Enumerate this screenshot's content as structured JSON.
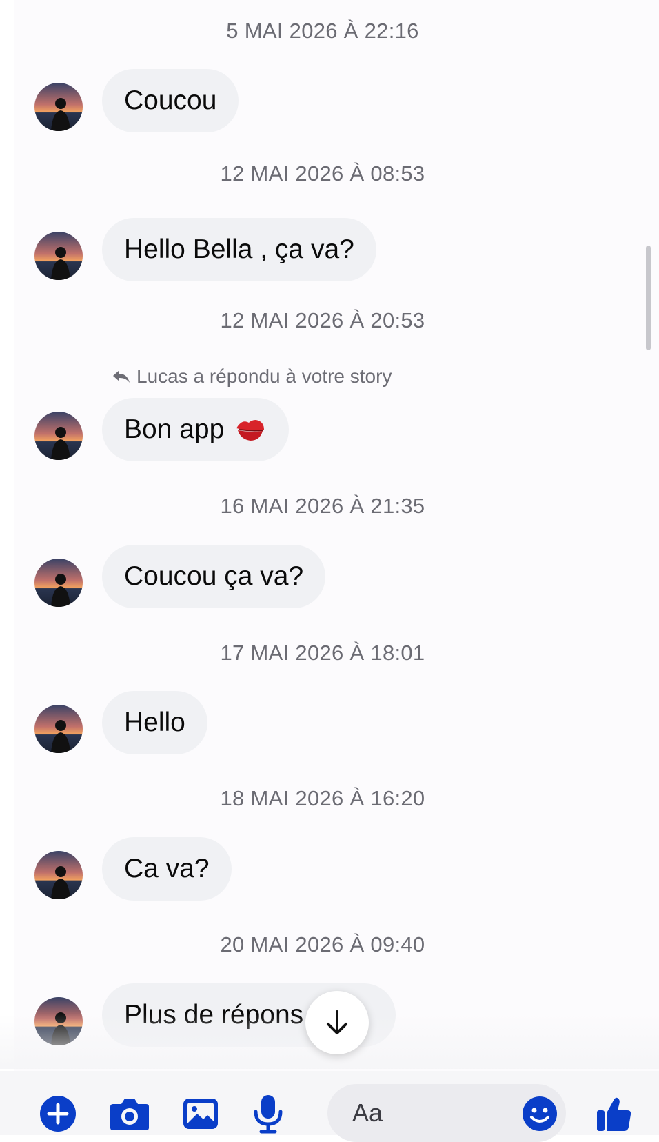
{
  "messages": [
    {
      "timestamp": "5 MAI 2026 À 22:16",
      "text": "Coucou"
    },
    {
      "timestamp": "12 MAI 2026 À 08:53",
      "text": "Hello Bella , ça va?"
    },
    {
      "timestamp": "12 MAI 2026 À 20:53",
      "reply_note": "Lucas a répondu à votre story",
      "text": "Bon app",
      "emoji": "kiss-mark-emoji"
    },
    {
      "timestamp": "16 MAI 2026 À 21:35",
      "text": "Coucou ça va?"
    },
    {
      "timestamp": "17 MAI 2026 À 18:01",
      "text": "Hello"
    },
    {
      "timestamp": "18 MAI 2026 À 16:20",
      "text": "Ca va?"
    },
    {
      "timestamp": "20 MAI 2026 À 09:40",
      "text": "Plus de répons"
    }
  ],
  "composer": {
    "placeholder": "Aa",
    "icons": [
      "plus-icon",
      "camera-icon",
      "image-icon",
      "microphone-icon",
      "emoji-icon",
      "thumbs-up-icon"
    ]
  },
  "colors": {
    "accent": "#0a3ec8",
    "bubble": "#f0f1f4",
    "timestamp_text": "#6b6b73"
  }
}
